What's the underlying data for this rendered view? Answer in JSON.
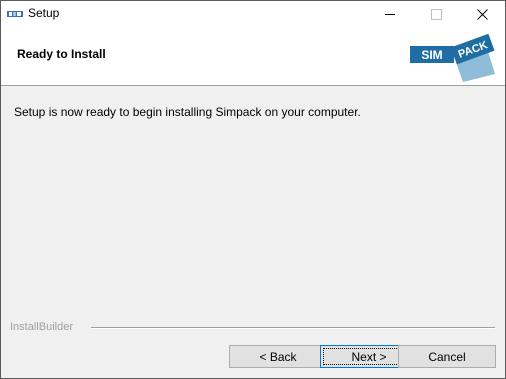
{
  "window": {
    "title": "Setup",
    "icon": "installer-app-icon",
    "controls": {
      "minimize": "minimize-icon",
      "maximize": "maximize-icon",
      "close": "close-icon"
    }
  },
  "header": {
    "title": "Ready to Install",
    "logo": {
      "word1": "SIM",
      "word2": "PACK",
      "colors": {
        "dark": "#1f6ea3",
        "light": "#8fbcd8"
      }
    }
  },
  "body": {
    "message": "Setup is now ready to begin installing Simpack on your computer."
  },
  "footer": {
    "brand": "InstallBuilder",
    "buttons": {
      "back": "< Back",
      "next": "Next >",
      "cancel": "Cancel"
    }
  }
}
